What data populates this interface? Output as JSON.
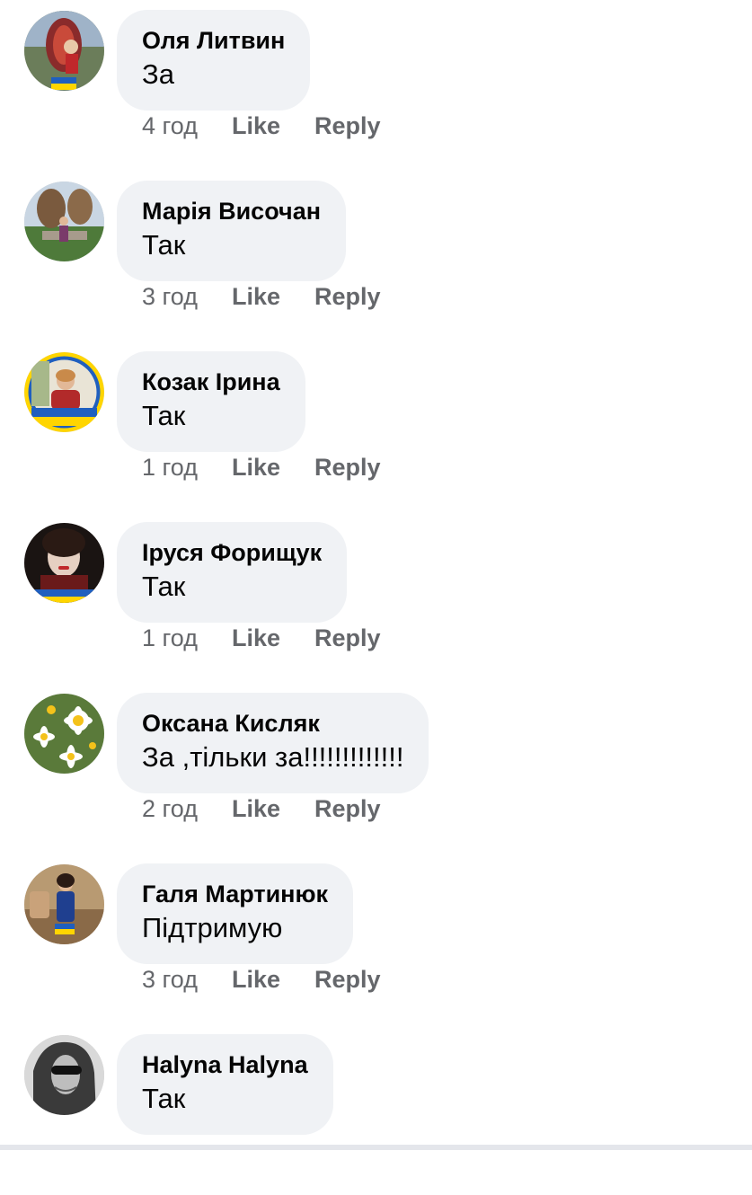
{
  "comments": [
    {
      "author": "Оля Литвин",
      "text": "За",
      "time": "4 год",
      "like": "Like",
      "reply": "Reply"
    },
    {
      "author": "Марія Височан",
      "text": "Так",
      "time": "3 год",
      "like": "Like",
      "reply": "Reply"
    },
    {
      "author": "Козак Ірина",
      "text": "Так",
      "time": "1 год",
      "like": "Like",
      "reply": "Reply"
    },
    {
      "author": "Іруся Форищук",
      "text": "Так",
      "time": "1 год",
      "like": "Like",
      "reply": "Reply"
    },
    {
      "author": "Оксана Кисляк",
      "text": "За ,тільки за!!!!!!!!!!!!!",
      "time": "2 год",
      "like": "Like",
      "reply": "Reply"
    },
    {
      "author": "Галя Мартинюк",
      "text": "Підтримую",
      "time": "3 год",
      "like": "Like",
      "reply": "Reply"
    },
    {
      "author": "Halyna Halyna",
      "text": "Так",
      "time": "",
      "like": "",
      "reply": ""
    }
  ],
  "colors": {
    "bubble_bg": "#f0f2f5",
    "meta_text": "#65676b",
    "author_text": "#050505",
    "ukraine_blue": "#1f5fbf",
    "ukraine_yellow": "#ffd500"
  }
}
